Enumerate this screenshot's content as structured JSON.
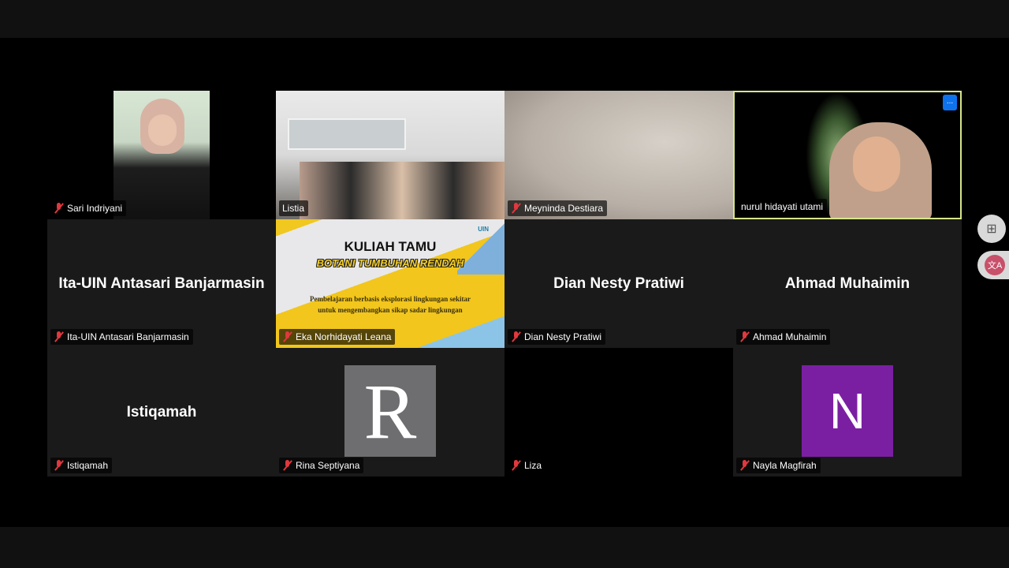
{
  "participants": [
    {
      "name": "Sari Indriyani",
      "muted": true,
      "video": true
    },
    {
      "name": "Listia",
      "muted": false,
      "video": true
    },
    {
      "name": "Meyninda Destiara",
      "muted": true,
      "video": true
    },
    {
      "name": "nurul hidayati utami",
      "muted": false,
      "video": true,
      "active_speaker": true
    },
    {
      "name": "Ita-UIN Antasari Banjarmasin",
      "muted": true,
      "video": false
    },
    {
      "name": "Eka Norhidayati Leana",
      "muted": true,
      "video": true
    },
    {
      "name": "Dian Nesty Pratiwi",
      "muted": true,
      "video": false
    },
    {
      "name": "Ahmad Muhaimin",
      "muted": true,
      "video": false
    },
    {
      "name": "Istiqamah",
      "muted": true,
      "video": false
    },
    {
      "name": "Rina Septiyana",
      "muted": true,
      "video": false,
      "avatar_letter": "R"
    },
    {
      "name": "Liza",
      "muted": true,
      "video": false
    },
    {
      "name": "Nayla Magfirah",
      "muted": true,
      "video": false,
      "avatar_letter": "N"
    }
  ],
  "slide": {
    "title": "KULIAH TAMU",
    "subtitle": "BOTANI TUMBUHAN RENDAH",
    "line1": "Pembelajaran berbasis eksplorasi lingkungan sekitar",
    "line2": "untuk mengembangkan sikap sadar lingkungan",
    "logo": "UIN"
  },
  "more_button": "...",
  "colors": {
    "active_border": "#d6e58a",
    "muted_icon": "#e0383e",
    "more_button": "#0e72ed",
    "nayla_avatar": "#7b1fa2"
  }
}
